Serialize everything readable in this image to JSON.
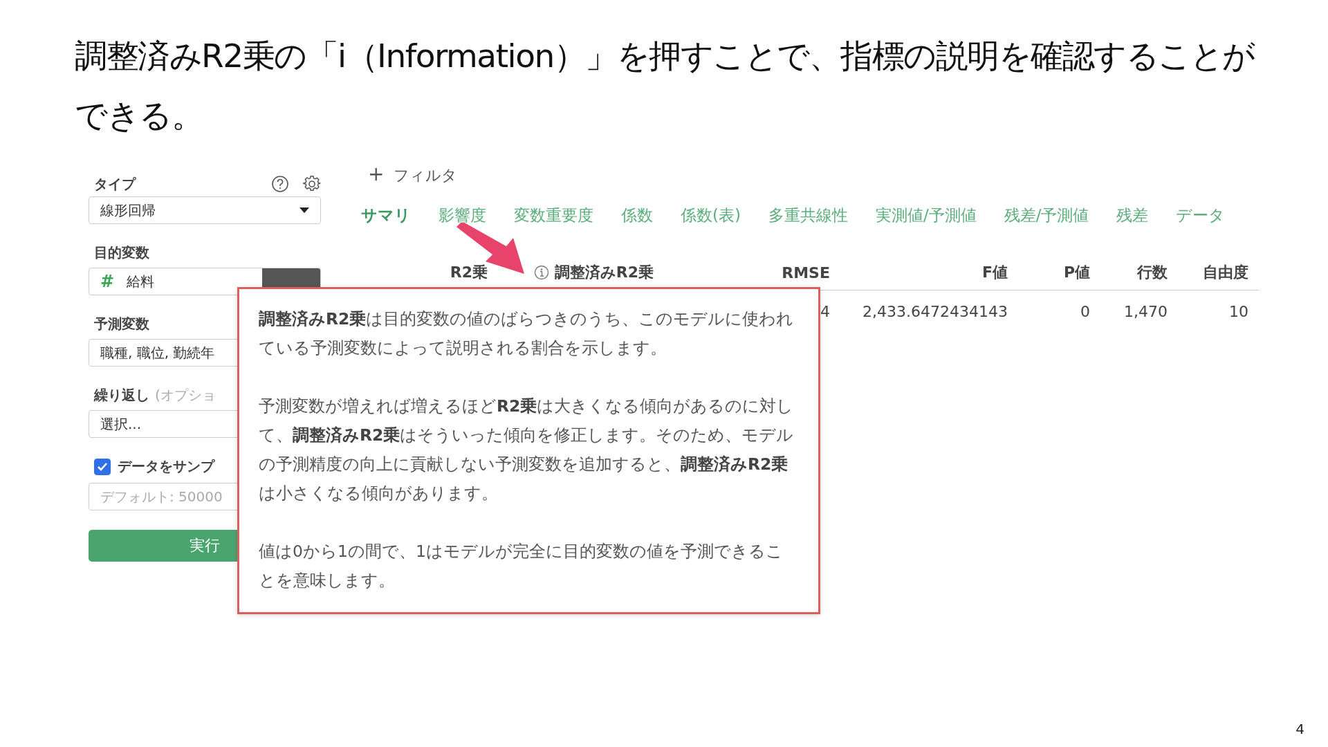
{
  "slide_title": "調整済みR2乗の「i（Information）」を押すことで、指標の説明を確認することができる。",
  "settings_panel": {
    "type_label": "タイプ",
    "type_value": "線形回帰",
    "target_label": "目的変数",
    "target_icon": "#",
    "target_value": "給料",
    "predictor_label": "予測変数",
    "predictor_value": "職種, 職位, 勤続年",
    "repeat_label": "繰り返し",
    "repeat_hint": "(オプショ",
    "repeat_value": "選択...",
    "sample": {
      "label": "データをサンプ",
      "checked": true
    },
    "sample_placeholder": "デフォルト: 50000",
    "run_button": "実行"
  },
  "filter": {
    "icon": "+",
    "label": "フィルタ"
  },
  "tabs": [
    {
      "label": "サマリ",
      "selected": true
    },
    {
      "label": "影響度",
      "selected": false
    },
    {
      "label": "変数重要度",
      "selected": false
    },
    {
      "label": "係数",
      "selected": false
    },
    {
      "label": "係数(表)",
      "selected": false
    },
    {
      "label": "多重共線性",
      "selected": false
    },
    {
      "label": "実測値/予測値",
      "selected": false
    },
    {
      "label": "残差/予測値",
      "selected": false
    },
    {
      "label": "残差",
      "selected": false
    },
    {
      "label": "データ",
      "selected": false
    }
  ],
  "table": {
    "columns": [
      "R2乗",
      "調整済みR2乗",
      "RMSE",
      "F値",
      "P値",
      "行数",
      "自由度"
    ],
    "rows": [
      [
        "",
        "",
        "4",
        "2,433.6472434143",
        "0",
        "1,470",
        "10"
      ]
    ]
  },
  "tooltip": {
    "paragraphs": [
      "**調整済みR2乗**は目的変数の値のばらつきのうち、このモデルに使われている予測変数によって説明される割合を示します。",
      "予測変数が増えれば増えるほど**R2乗**は大きくなる傾向があるのに対して、**調整済みR2乗**はそういった傾向を修正します。そのため、モデルの予測精度の向上に貢献しない予測変数を追加すると、**調整済みR2乗**は小さくなる傾向があります。",
      "値は0から1の間で、1はモデルが完全に目的変数の値を予測できることを意味します。"
    ]
  },
  "page_number": "4"
}
